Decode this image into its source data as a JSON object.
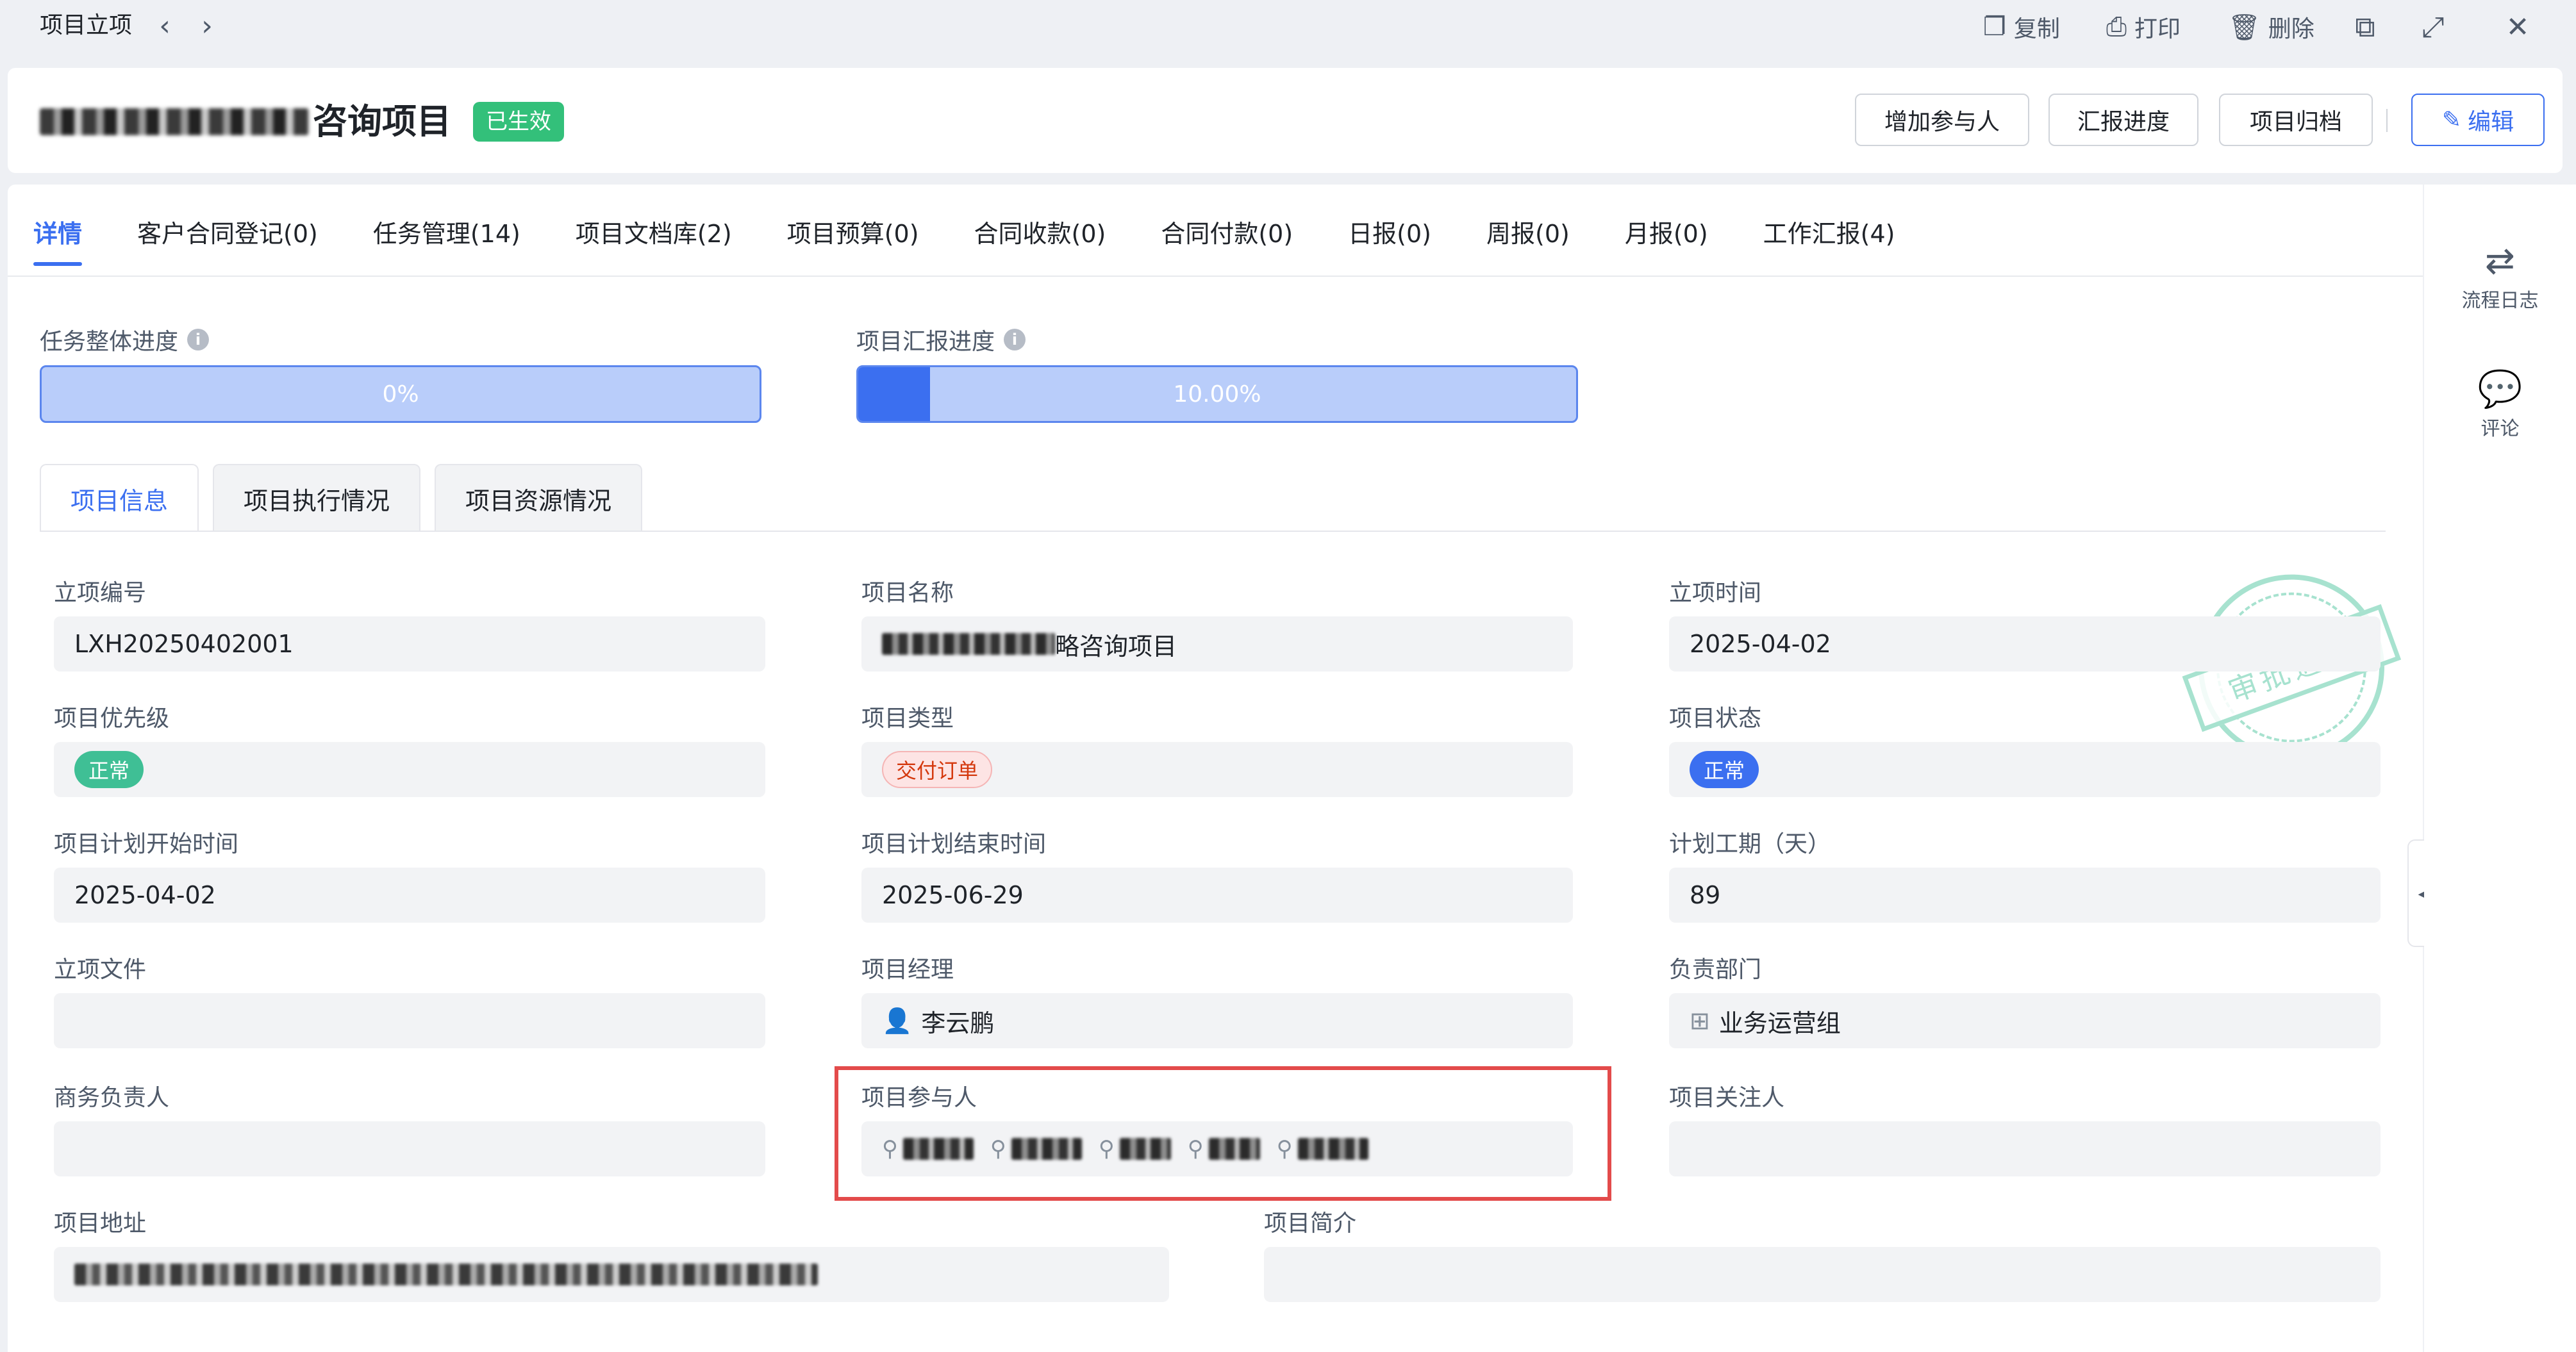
{
  "topbar": {
    "breadcrumb": "项目立项",
    "actions": {
      "copy": "复制",
      "print": "打印",
      "delete": "删除"
    }
  },
  "header": {
    "title_suffix": "咨询项目",
    "status_badge": "已生效",
    "buttons": {
      "add_participant": "增加参与人",
      "report_progress": "汇报进度",
      "archive": "项目归档",
      "edit": "编辑"
    }
  },
  "tabs": [
    {
      "label": "详情"
    },
    {
      "label": "客户合同登记(0)"
    },
    {
      "label": "任务管理(14)"
    },
    {
      "label": "项目文档库(2)"
    },
    {
      "label": "项目预算(0)"
    },
    {
      "label": "合同收款(0)"
    },
    {
      "label": "合同付款(0)"
    },
    {
      "label": "日报(0)"
    },
    {
      "label": "周报(0)"
    },
    {
      "label": "月报(0)"
    },
    {
      "label": "工作汇报(4)"
    }
  ],
  "progress": {
    "task": {
      "label": "任务整体进度",
      "text": "0%",
      "fraction": 0.0
    },
    "report": {
      "label": "项目汇报进度",
      "text": "10.00%",
      "fraction": 0.1
    }
  },
  "subtabs": [
    "项目信息",
    "项目执行情况",
    "项目资源情况"
  ],
  "stamp": "审批通过",
  "fields": {
    "project_no": {
      "label": "立项编号",
      "value": "LXH20250402001"
    },
    "project_name": {
      "label": "项目名称",
      "value_suffix": "略咨询项目"
    },
    "setup_time": {
      "label": "立项时间",
      "value": "2025-04-02"
    },
    "priority": {
      "label": "项目优先级",
      "tag": "正常"
    },
    "type": {
      "label": "项目类型",
      "tag": "交付订单"
    },
    "status": {
      "label": "项目状态",
      "tag": "正常"
    },
    "plan_start": {
      "label": "项目计划开始时间",
      "value": "2025-04-02"
    },
    "plan_end": {
      "label": "项目计划结束时间",
      "value": "2025-06-29"
    },
    "duration": {
      "label": "计划工期（天）",
      "value": "89"
    },
    "setup_file": {
      "label": "立项文件",
      "value": ""
    },
    "manager": {
      "label": "项目经理",
      "value": "李云鹏"
    },
    "department": {
      "label": "负责部门",
      "value": "业务运营组"
    },
    "business_owner": {
      "label": "商务负责人",
      "value": ""
    },
    "participants": {
      "label": "项目参与人"
    },
    "followers": {
      "label": "项目关注人",
      "value": ""
    },
    "address": {
      "label": "项目地址"
    },
    "intro": {
      "label": "项目简介",
      "value": ""
    }
  },
  "right_sidebar": {
    "flow_log": "流程日志",
    "comments": "评论"
  },
  "colors": {
    "accent": "#3b6ff0",
    "success": "#33c07a",
    "highlight_border": "#e34b4b"
  }
}
